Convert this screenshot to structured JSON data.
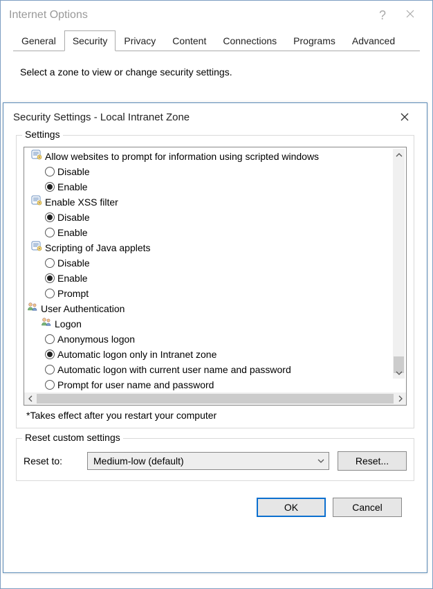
{
  "bg": {
    "title": "Internet Options",
    "help": "?",
    "tabs": [
      "General",
      "Security",
      "Privacy",
      "Content",
      "Connections",
      "Programs",
      "Advanced"
    ],
    "active_tab": 1,
    "body_text": "Select a zone to view or change security settings."
  },
  "dialog": {
    "title": "Security Settings - Local Intranet Zone",
    "settings_legend": "Settings",
    "tree": {
      "items": [
        {
          "type": "script",
          "label": "Allow websites to prompt for information using scripted windows"
        },
        {
          "type": "radio",
          "label": "Disable",
          "checked": false
        },
        {
          "type": "radio",
          "label": "Enable",
          "checked": true
        },
        {
          "type": "script",
          "label": "Enable XSS filter"
        },
        {
          "type": "radio",
          "label": "Disable",
          "checked": true
        },
        {
          "type": "radio",
          "label": "Enable",
          "checked": false
        },
        {
          "type": "script",
          "label": "Scripting of Java applets"
        },
        {
          "type": "radio",
          "label": "Disable",
          "checked": false
        },
        {
          "type": "radio",
          "label": "Enable",
          "checked": true
        },
        {
          "type": "radio",
          "label": "Prompt",
          "checked": false
        },
        {
          "type": "users-cat",
          "label": "User Authentication"
        },
        {
          "type": "users-sub",
          "label": "Logon"
        },
        {
          "type": "radio",
          "label": "Anonymous logon",
          "checked": false
        },
        {
          "type": "radio",
          "label": "Automatic logon only in Intranet zone",
          "checked": true
        },
        {
          "type": "radio",
          "label": "Automatic logon with current user name and password",
          "checked": false
        },
        {
          "type": "radio",
          "label": "Prompt for user name and password",
          "checked": false
        }
      ]
    },
    "footnote": "*Takes effect after you restart your computer",
    "reset_legend": "Reset custom settings",
    "reset_label": "Reset to:",
    "reset_value": "Medium-low (default)",
    "reset_button": "Reset...",
    "ok": "OK",
    "cancel": "Cancel"
  }
}
